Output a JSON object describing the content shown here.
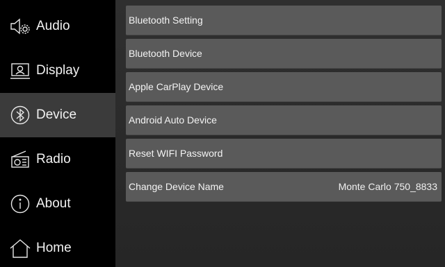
{
  "sidebar": {
    "items": [
      {
        "label": "Audio",
        "icon": "audio-settings-icon",
        "active": false
      },
      {
        "label": "Display",
        "icon": "display-icon",
        "active": false
      },
      {
        "label": "Device",
        "icon": "bluetooth-icon",
        "active": true
      },
      {
        "label": "Radio",
        "icon": "radio-icon",
        "active": false
      },
      {
        "label": "About",
        "icon": "info-icon",
        "active": false
      },
      {
        "label": "Home",
        "icon": "home-icon",
        "active": false
      }
    ]
  },
  "main": {
    "rows": [
      {
        "label": "Bluetooth Setting",
        "value": ""
      },
      {
        "label": "Bluetooth Device",
        "value": ""
      },
      {
        "label": "Apple CarPlay Device",
        "value": ""
      },
      {
        "label": "Android Auto Device",
        "value": ""
      },
      {
        "label": "Reset WIFI Password",
        "value": ""
      },
      {
        "label": "Change Device Name",
        "value": "Monte Carlo 750_8833"
      }
    ]
  },
  "colors": {
    "sidebar_bg": "#000000",
    "active_bg": "#3b3b3b",
    "row_bg": "#5a5a5a",
    "content_bg": "#2b2b2b",
    "text": "#f2f2f2"
  }
}
